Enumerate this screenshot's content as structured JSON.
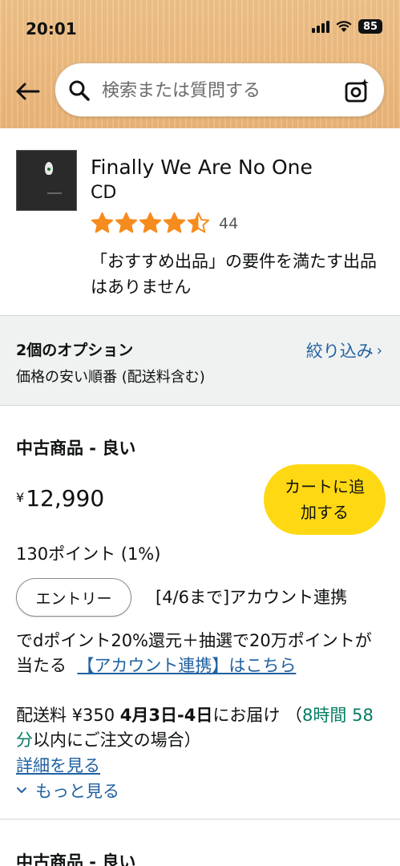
{
  "status_bar": {
    "time": "20:01",
    "battery": "85"
  },
  "search": {
    "placeholder": "検索または質問する"
  },
  "product": {
    "title": "Finally We Are No One",
    "format": "CD",
    "rating": 4.5,
    "rating_count": "44",
    "notice": "「おすすめ出品」の要件を満たす出品はありません"
  },
  "options": {
    "count": "2個のオプション",
    "sort": "価格の安い順番 (配送料含む)",
    "filter": "絞り込み"
  },
  "offer": {
    "condition": "中古商品 - 良い",
    "currency": "¥",
    "price": "12,990",
    "cart_button": "カートに追加する",
    "points": "130ポイント (1%)",
    "entry_button": "エントリー",
    "promo_first": "[4/6まで]アカウント連携",
    "promo_rest": "でdポイント20%還元＋抽選で20万ポイントが当たる",
    "promo_link": "【アカウント連携】はこちら",
    "delivery_prefix": "配送料 ¥350 ",
    "delivery_date": "4月3日-4日",
    "delivery_mid": "にお届け （",
    "countdown": "8時間 58 分",
    "delivery_suffix": "以内にご注文の場合）",
    "details_link": "詳細を見る",
    "more_link": "もっと見る"
  },
  "next_offer": {
    "condition": "中古商品 - 良い"
  },
  "colors": {
    "accent_link": "#2162a1",
    "star": "#f68b1e",
    "cart_button": "#ffd814",
    "countdown_green": "#067d62"
  }
}
